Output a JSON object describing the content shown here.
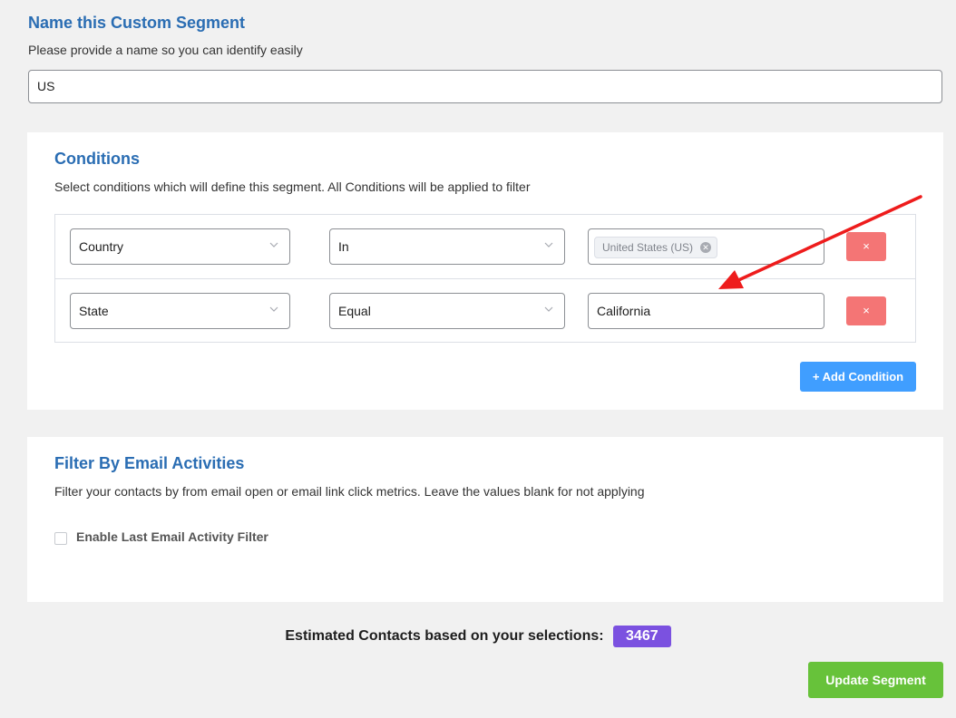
{
  "segment": {
    "heading": "Name this Custom Segment",
    "description": "Please provide a name so you can identify easily",
    "name_value": "US"
  },
  "conditions": {
    "heading": "Conditions",
    "description": "Select conditions which will define this segment. All Conditions will be applied to filter",
    "rows": [
      {
        "field": "Country",
        "operator": "In",
        "value_tag": "United States (US)",
        "delete_label": "×"
      },
      {
        "field": "State",
        "operator": "Equal",
        "value": "California",
        "delete_label": "×"
      }
    ],
    "add_button_label": "+ Add Condition"
  },
  "activities": {
    "heading": "Filter By Email Activities",
    "description": "Filter your contacts by from email open or email link click metrics. Leave the values blank for not applying",
    "checkbox_label": "Enable Last Email Activity Filter",
    "checkbox_checked": false
  },
  "estimate": {
    "label": "Estimated Contacts based on your selections:",
    "count": "3467"
  },
  "update_button_label": "Update Segment",
  "colors": {
    "accent_blue": "#2a6db3",
    "add_button": "#409eff",
    "delete_button": "#f47575",
    "update_button": "#67c23a",
    "count_badge": "#7b51e0",
    "annotation_arrow": "#ee1c1c"
  },
  "icons": {
    "chevron": "chevron-down-icon",
    "tag_close": "tag-close-icon",
    "arrow": "annotation-arrow-icon"
  }
}
